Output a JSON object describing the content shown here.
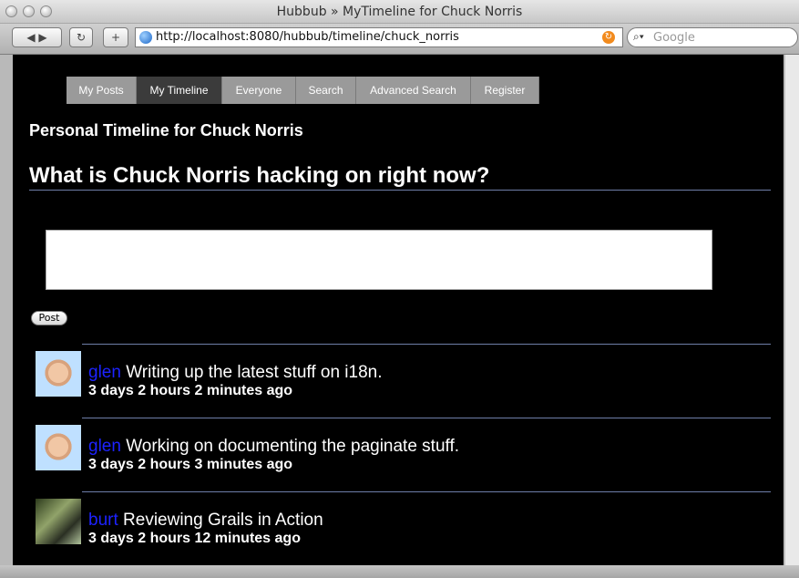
{
  "window": {
    "title": "Hubbub » MyTimeline for Chuck Norris"
  },
  "toolbar": {
    "back_label": "◀ ▶",
    "reload_label": "↻",
    "add_label": "+",
    "url": "http://localhost:8080/hubbub/timeline/chuck_norris",
    "rss_label": "↻",
    "search_placeholder": "Google"
  },
  "nav": {
    "tabs": [
      {
        "label": "My Posts"
      },
      {
        "label": "My Timeline"
      },
      {
        "label": "Everyone"
      },
      {
        "label": "Search"
      },
      {
        "label": "Advanced Search"
      },
      {
        "label": "Register"
      }
    ]
  },
  "main": {
    "heading": "Personal Timeline for Chuck Norris",
    "prompt": "What is Chuck Norris hacking on right now?",
    "post_button": "Post",
    "posts": [
      {
        "user": "glen",
        "text": "Writing up the latest stuff on i18n.",
        "time": "3 days 2 hours 2 minutes ago",
        "avatar": "glen"
      },
      {
        "user": "glen",
        "text": "Working on documenting the paginate stuff.",
        "time": "3 days 2 hours 3 minutes ago",
        "avatar": "glen"
      },
      {
        "user": "burt",
        "text": "Reviewing Grails in Action",
        "time": "3 days 2 hours 12 minutes ago",
        "avatar": "burt"
      }
    ]
  },
  "colors": {
    "background": "#000000",
    "username": "#1d23ff",
    "tab_active": "#3b3b3b",
    "tab_inactive": "#9a9a9a"
  }
}
